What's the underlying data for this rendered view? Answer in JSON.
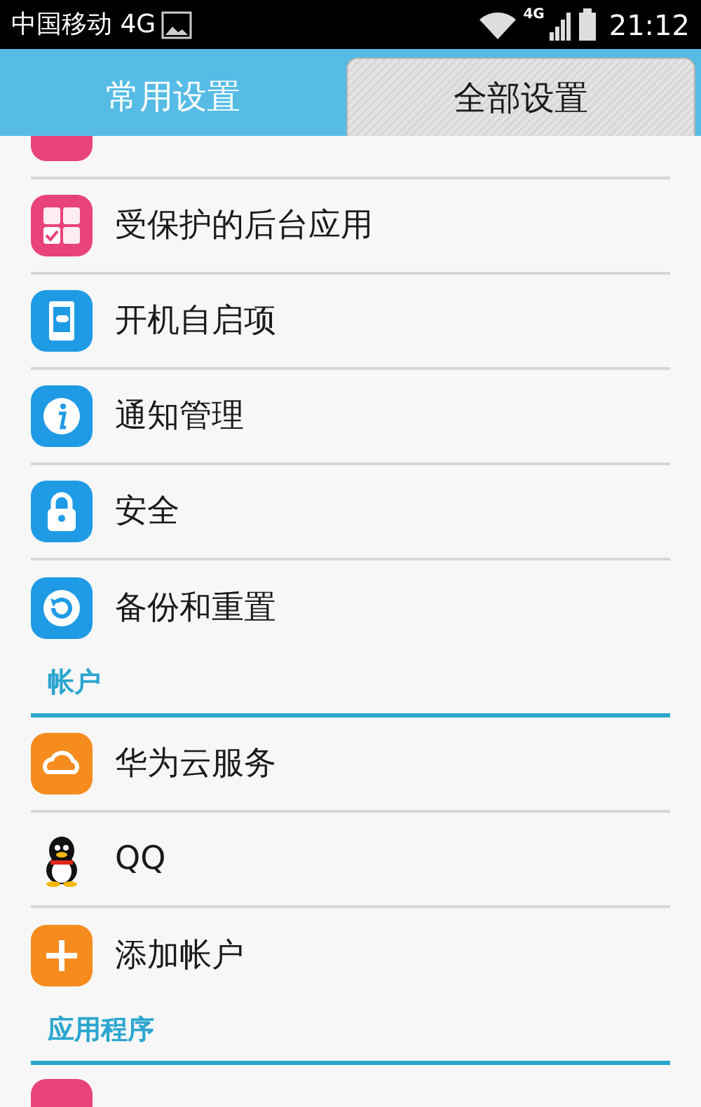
{
  "status_bar": {
    "carrier": "中国移动 4G",
    "network": "4G",
    "time": "21:12"
  },
  "tabs": [
    {
      "label": "常用设置",
      "selected": false
    },
    {
      "label": "全部设置",
      "selected": true
    }
  ],
  "sections": [
    {
      "items": [
        {
          "label": "受保护的后台应用"
        },
        {
          "label": "开机自启项"
        },
        {
          "label": "通知管理"
        },
        {
          "label": "安全"
        },
        {
          "label": "备份和重置"
        }
      ]
    },
    {
      "header": "帐户",
      "items": [
        {
          "label": "华为云服务"
        },
        {
          "label": "QQ"
        },
        {
          "label": "添加帐户"
        }
      ]
    },
    {
      "header": "应用程序"
    }
  ]
}
